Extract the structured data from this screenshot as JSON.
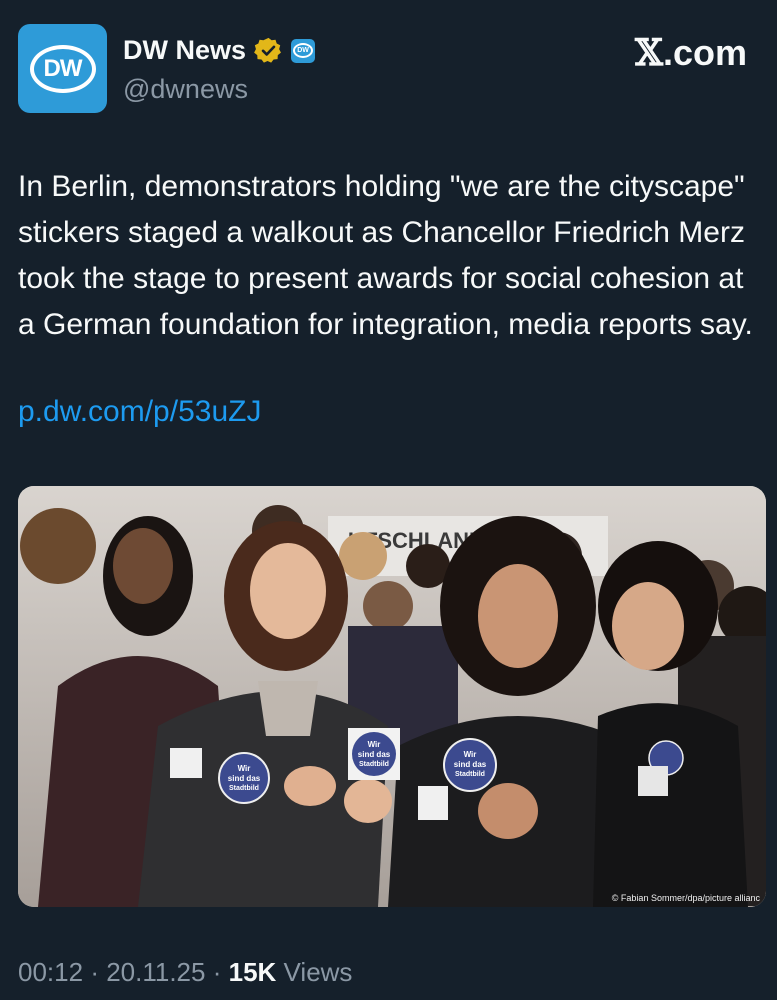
{
  "account": {
    "name": "DW News",
    "handle": "@dwnews",
    "avatar_text": "DW",
    "affiliate_text": "DW"
  },
  "site": {
    "label": "X.com",
    "logo": "𝕏",
    "suffix": ".com"
  },
  "tweet": {
    "text": "In Berlin, demonstrators holding \"we are the cityscape\" stickers staged a walkout as Chancellor Friedrich Merz took the stage to present awards for social cohesion at a German foundation for integration, media reports say.",
    "link": "p.dw.com/p/53uZJ"
  },
  "media": {
    "banner_text": "UTSCHLANDST",
    "sticker_text": [
      "Wir",
      "sind das",
      "Stadtbild"
    ],
    "credit": "© Fabian Sommer/dpa/picture allianc"
  },
  "meta": {
    "time": "00:12",
    "date": "20.11.25",
    "views_count": "15K",
    "views_label": "Views"
  },
  "colors": {
    "background": "#15202b",
    "link": "#1d9bf0",
    "verified": "#e2b719",
    "brand": "#2e9bd8"
  }
}
